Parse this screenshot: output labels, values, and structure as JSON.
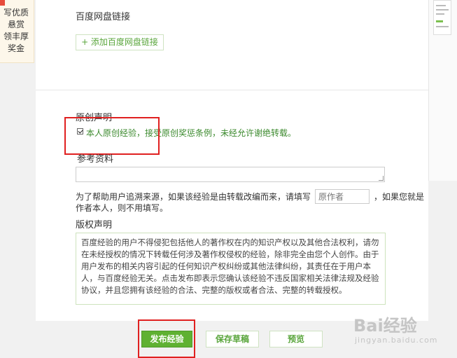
{
  "left_banner": {
    "text": "写优质\n悬赏\n领丰厚\n奖金"
  },
  "baidu_pan": {
    "title": "百度网盘链接",
    "add_button": "+ 添加百度网盘链接"
  },
  "original": {
    "title": "原创声明",
    "checked": true,
    "text": "本人原创经验，接受原创奖惩条例，未经允许谢绝转载。"
  },
  "reference": {
    "title": "参考资料",
    "hint_before": "为了帮助用户追溯来源，如果该经验是由转载改编而来，请填写",
    "author_placeholder": "原作者",
    "hint_after": "，如果您就是作者本人，则不用填写。"
  },
  "copyright": {
    "title": "版权声明",
    "text": "百度经验的用户不得侵犯包括他人的著作权在内的知识产权以及其他合法权利，请勿在未经授权的情况下转载任何涉及著作权侵权的经验，除非完全由您个人创作。由于用户发布的相关内容引起的任何知识产权纠纷或其他法律纠纷，其责任在于用户本人，与百度经验无关。点击发布即表示您确认该经验不违反国家相关法律法规及经验协议，并且您拥有该经验的合法、完整的版权或者合法、完整的转载授权。"
  },
  "actions": {
    "publish": "发布经验",
    "save_draft": "保存草稿",
    "preview": "预览"
  },
  "watermark": {
    "main": "Bai经验",
    "sub": "jingyan.baidu.com"
  },
  "colors": {
    "accent_green": "#5fb132",
    "link_green": "#3c8a2e",
    "highlight_red": "#e02020"
  }
}
